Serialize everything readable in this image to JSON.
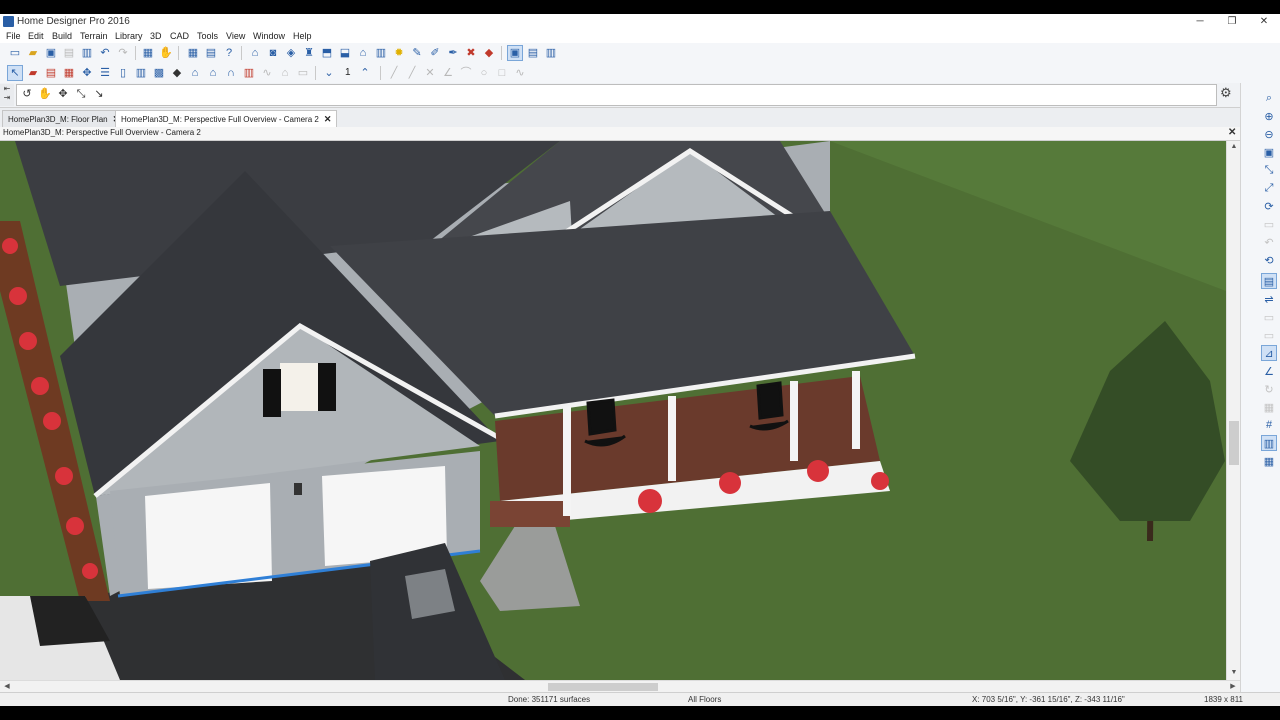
{
  "window": {
    "title": "Home Designer Pro 2016",
    "minimize": "─",
    "restore": "❐",
    "close": "✕"
  },
  "menu": [
    "File",
    "Edit",
    "Build",
    "Terrain",
    "Library",
    "3D",
    "CAD",
    "Tools",
    "View",
    "Window",
    "Help"
  ],
  "toolbar2": {
    "floor_number": "1"
  },
  "tabs": [
    {
      "label": "HomePlan3D_M: Floor Plan",
      "close": "✕"
    },
    {
      "label": "HomePlan3D_M: Perspective Full Overview - Camera 2",
      "close": "✕"
    }
  ],
  "view": {
    "title": "HomePlan3D_M: Perspective Full Overview - Camera 2",
    "close": "✕"
  },
  "status": {
    "message": "Done: 351171 surfaces",
    "floors": "All Floors",
    "coords": "X: 703 5/16\", Y: -361 15/16\", Z: -343 11/16\"",
    "size": "1839 x 811"
  },
  "colors": {
    "accent": "#2a5fa6",
    "grass": "#4e6e33",
    "roof": "#3b3d42",
    "siding": "#a9aeb3",
    "deck": "#6a3a2c",
    "flowers": "#d8333b"
  }
}
